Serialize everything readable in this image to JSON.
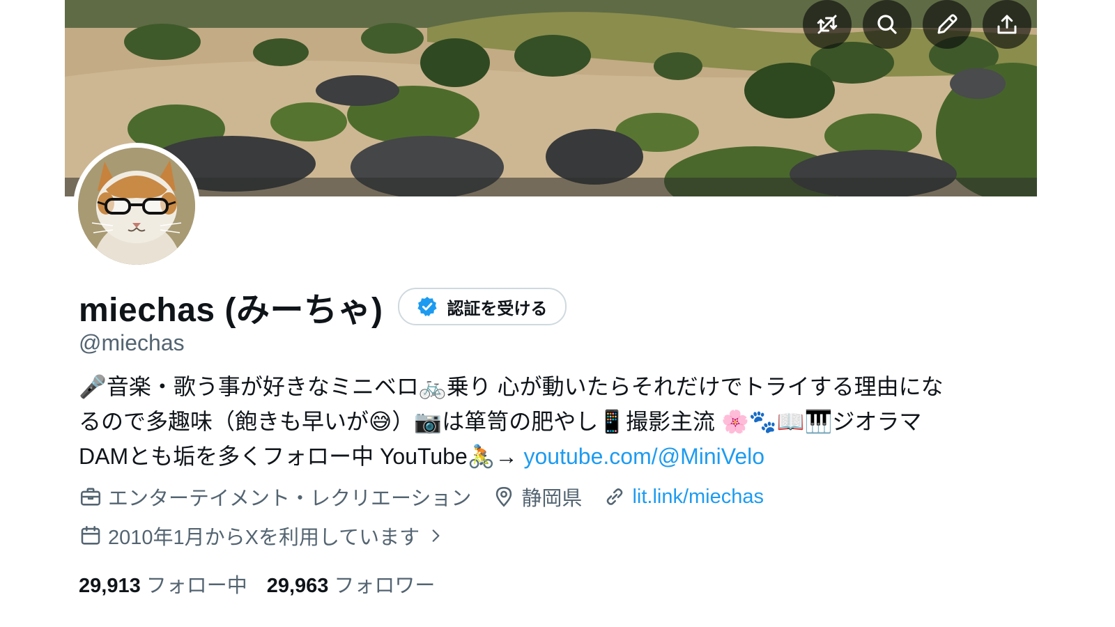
{
  "header": {
    "icons": [
      "hide-reposts-icon",
      "search-icon",
      "edit-icon",
      "share-icon"
    ]
  },
  "profile": {
    "display_name": "miechas (みーちゃ)",
    "verify_button_label": "認証を受ける",
    "handle": "@miechas",
    "bio_line1": "🎤音楽・歌う事が好きなミニベロ🚲乗り 心が動いたらそれだけでトライする理由にな",
    "bio_line2": "るので多趣味（飽きも早いが😅）📷は箪笥の肥やし📱撮影主流 🌸🐾📖🎹ジオラマ",
    "bio_line3_text": "DAMとも垢を多くフォロー中 YouTube🚴→ ",
    "bio_link": "youtube.com/@MiniVelo",
    "category": "エンターテイメント・レクリエーション",
    "location": "静岡県",
    "website": "lit.link/miechas",
    "joined": "2010年1月からXを利用しています",
    "following_count": "29,913",
    "following_label": "フォロー中",
    "followers_count": "29,963",
    "followers_label": "フォロワー"
  },
  "colors": {
    "link": "#1d9bf0",
    "secondary_text": "#536471",
    "verified_badge": "#1d9bf0"
  }
}
